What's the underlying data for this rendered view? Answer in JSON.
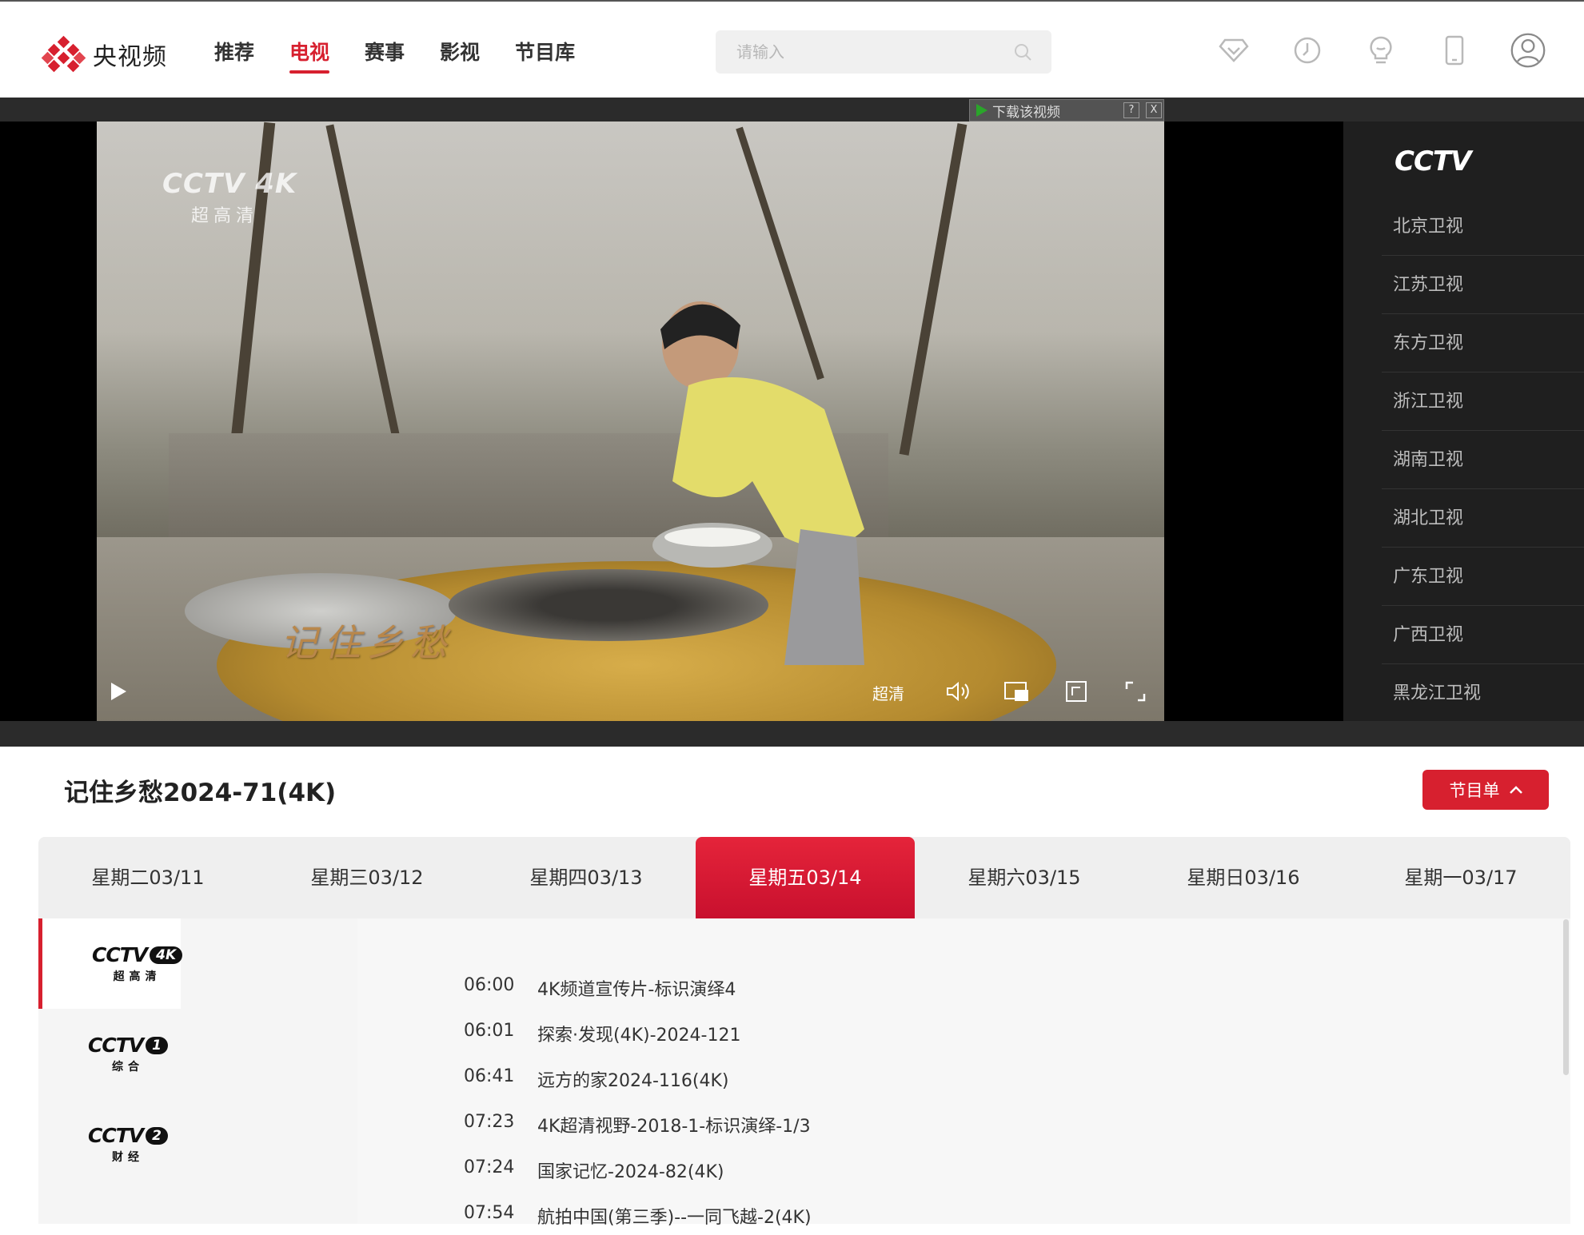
{
  "header": {
    "logo_text": "央视频",
    "nav": [
      {
        "label": "推荐",
        "active": false
      },
      {
        "label": "电视",
        "active": true
      },
      {
        "label": "赛事",
        "active": false
      },
      {
        "label": "影视",
        "active": false
      },
      {
        "label": "节目库",
        "active": false
      }
    ],
    "search_placeholder": "请输入",
    "icons": [
      "vip-diamond-icon",
      "history-clock-icon",
      "lightbulb-icon",
      "mobile-phone-icon",
      "user-avatar-icon"
    ]
  },
  "player": {
    "watermark_logo": "CCTV 4K",
    "watermark_sub": "超高清",
    "title_overlay": "记住乡愁",
    "download_bar": "下载该视频",
    "download_help": "?",
    "download_close": "X",
    "quality": "超清",
    "play_icon": "play-icon",
    "volume_icon": "volume-icon",
    "pip_icon": "picture-in-picture-icon",
    "webfullscreen_icon": "web-fullscreen-icon",
    "fullscreen_icon": "fullscreen-icon"
  },
  "channel_list": {
    "logo": "CCTV",
    "channels": [
      "北京卫视",
      "江苏卫视",
      "东方卫视",
      "浙江卫视",
      "湖南卫视",
      "湖北卫视",
      "广东卫视",
      "广西卫视",
      "黑龙江卫视"
    ]
  },
  "program": {
    "title": "记住乡愁2024-71(4K)",
    "epg_button": "节目单"
  },
  "days": [
    {
      "label": "星期二03/11",
      "active": false
    },
    {
      "label": "星期三03/12",
      "active": false
    },
    {
      "label": "星期四03/13",
      "active": false
    },
    {
      "label": "星期五03/14",
      "active": true
    },
    {
      "label": "星期六03/15",
      "active": false
    },
    {
      "label": "星期日03/16",
      "active": false
    },
    {
      "label": "星期一03/17",
      "active": false
    }
  ],
  "epg_channels": [
    {
      "word": "CCTV",
      "num": "4K",
      "sub": "超高清",
      "active": true
    },
    {
      "word": "CCTV",
      "num": "1",
      "sub": "综合",
      "active": false
    },
    {
      "word": "CCTV",
      "num": "2",
      "sub": "财经",
      "active": false
    }
  ],
  "schedule": [
    {
      "time": "06:00",
      "title": "4K频道宣传片-标识演绎4"
    },
    {
      "time": "06:01",
      "title": "探索·发现(4K)-2024-121"
    },
    {
      "time": "06:41",
      "title": "远方的家2024-116(4K)"
    },
    {
      "time": "07:23",
      "title": "4K超清视野-2018-1-标识演绎-1/3"
    },
    {
      "time": "07:24",
      "title": "国家记忆-2024-82(4K)"
    },
    {
      "time": "07:54",
      "title": "航拍中国(第三季)--一同飞越-2(4K)"
    }
  ],
  "colors": {
    "accent": "#d7202f",
    "player_bg": "#2b2b2b",
    "side_list_bg": "#1f1f1f"
  }
}
